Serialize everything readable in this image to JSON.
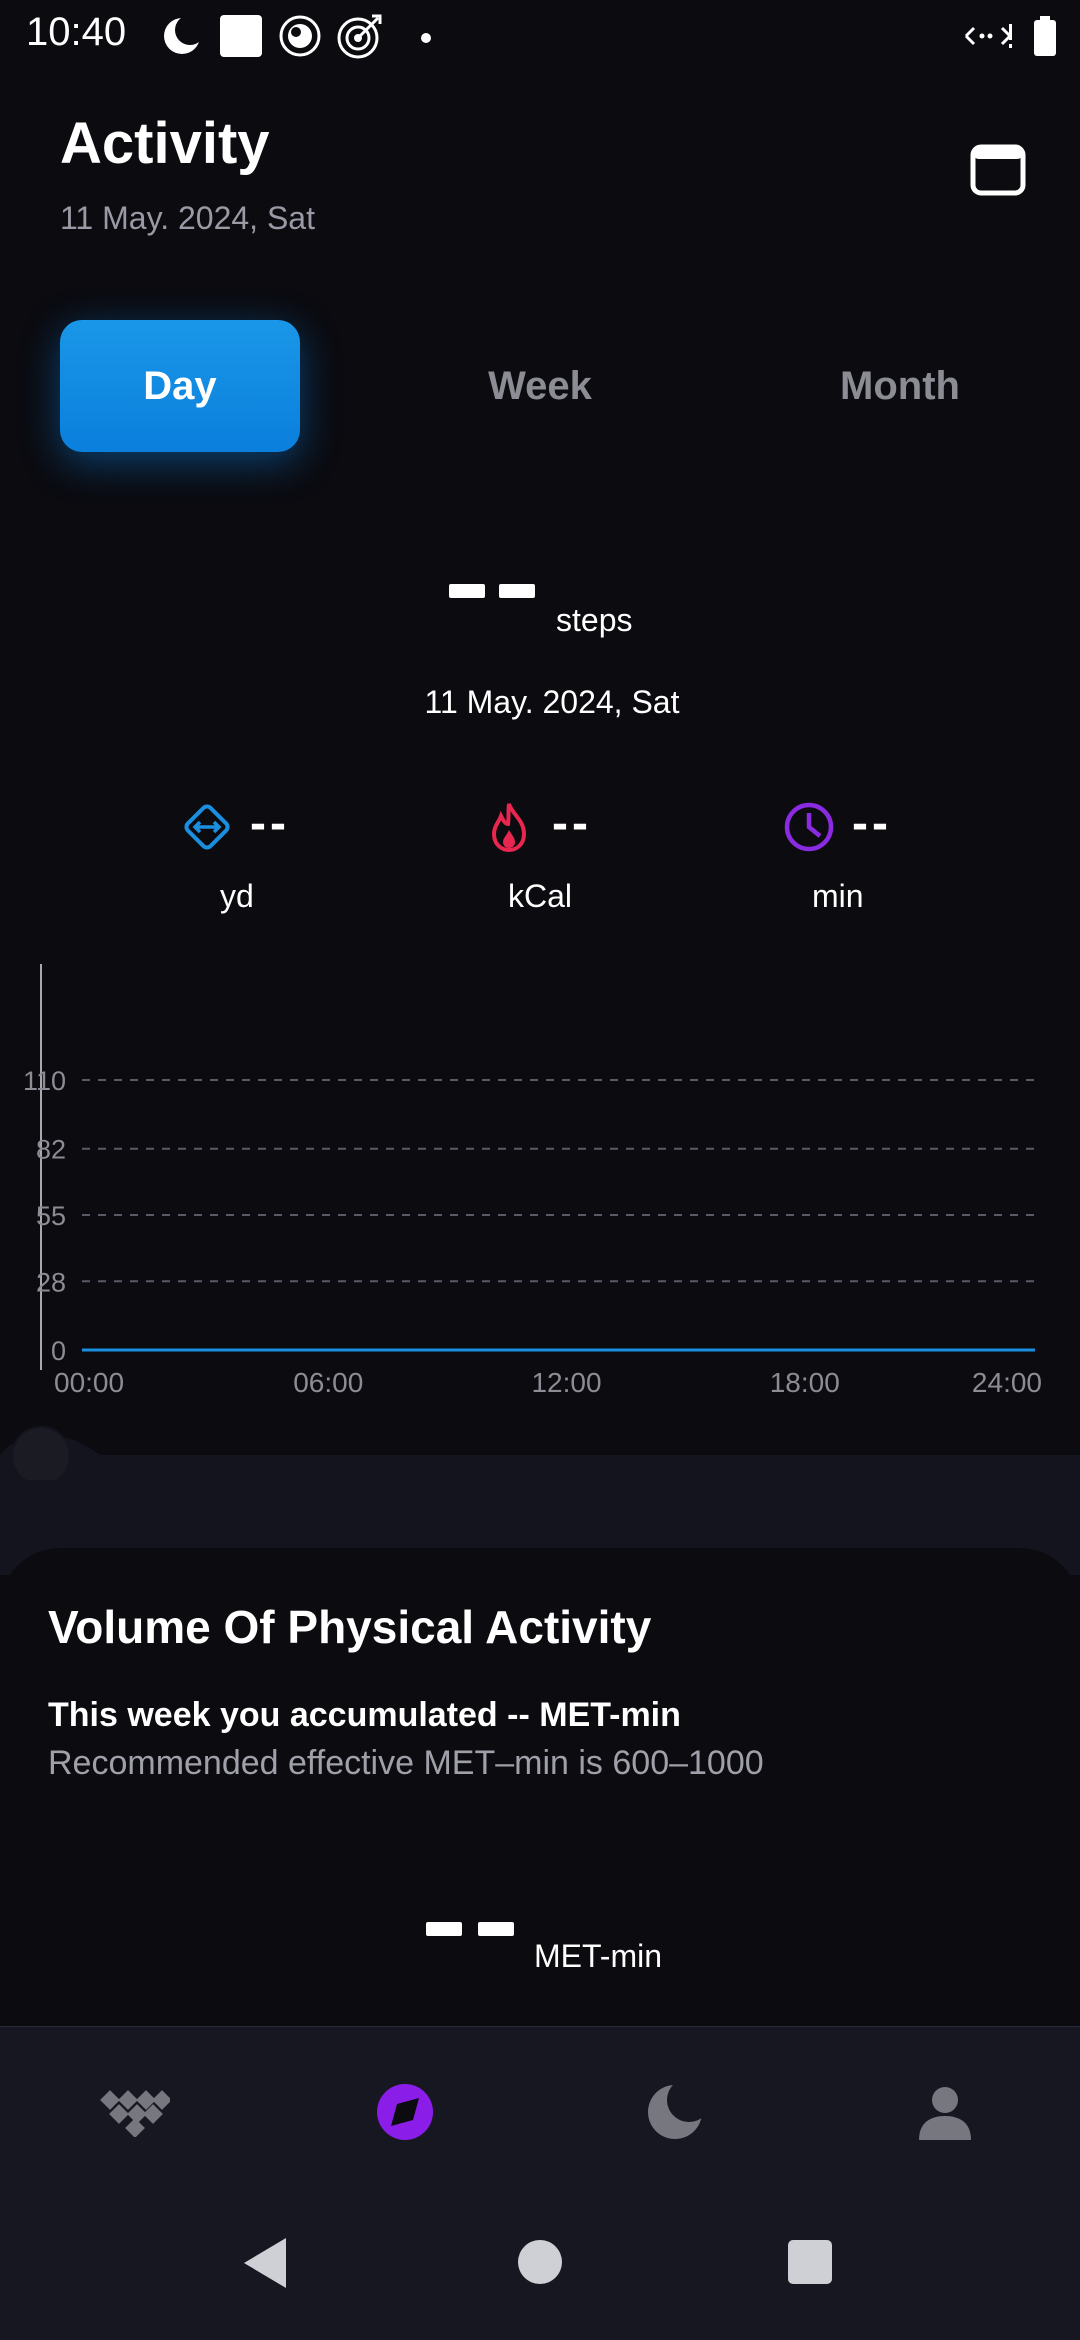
{
  "status_bar": {
    "time": "10:40",
    "left_icons": [
      "dnd-moon-icon",
      "square-icon",
      "vpn-icon",
      "target-icon",
      "dot-icon"
    ],
    "right_icons": [
      "network-icon",
      "battery-icon"
    ]
  },
  "header": {
    "title": "Activity",
    "date": "11 May. 2024, Sat",
    "calendar_icon": "calendar-icon"
  },
  "tabs": [
    {
      "label": "Day",
      "active": true
    },
    {
      "label": "Week",
      "active": false
    },
    {
      "label": "Month",
      "active": false
    }
  ],
  "steps": {
    "value": "--",
    "unit": "steps",
    "date": "11 May. 2024, Sat"
  },
  "metrics": [
    {
      "icon": "distance-icon",
      "value": "--",
      "unit": "yd",
      "color": "#1a8fe0"
    },
    {
      "icon": "flame-icon",
      "value": "--",
      "unit": "kCal",
      "color": "#e8264f"
    },
    {
      "icon": "clock-icon",
      "value": "--",
      "unit": "min",
      "color": "#8a2be2"
    }
  ],
  "chart_data": {
    "type": "line",
    "x": [
      "00:00",
      "06:00",
      "12:00",
      "18:00",
      "24:00"
    ],
    "y_ticks": [
      0,
      28,
      55,
      82,
      110
    ],
    "ylim": [
      0,
      110
    ],
    "series": [
      {
        "values": [
          0,
          0,
          0,
          0,
          0
        ],
        "color": "#1a8fe0"
      }
    ],
    "grid": true
  },
  "volume_panel": {
    "title": "Volume Of Physical Activity",
    "line1": "This week you accumulated -- MET-min",
    "line2": "Recommended effective MET–min is 600–1000",
    "value": "--",
    "unit": "MET-min"
  },
  "bottom_nav": [
    {
      "icon": "dashboard-icon",
      "active": false
    },
    {
      "icon": "activity-compass-icon",
      "active": true,
      "color": "#8a1ee8"
    },
    {
      "icon": "sleep-moon-icon",
      "active": false
    },
    {
      "icon": "profile-icon",
      "active": false
    }
  ],
  "system_nav": [
    "back-icon",
    "home-icon",
    "recents-icon"
  ]
}
